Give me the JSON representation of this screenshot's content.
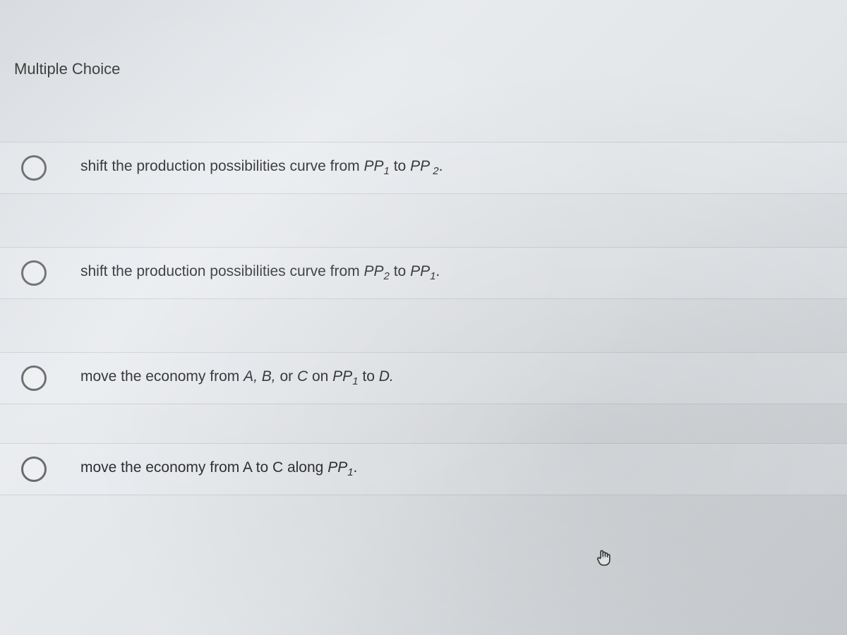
{
  "header": {
    "title": "Multiple Choice"
  },
  "options": [
    {
      "parts": [
        {
          "text": "shift the production possibilities curve from ",
          "italic": false
        },
        {
          "text": "PP",
          "italic": true
        },
        {
          "text": "1",
          "sub": true
        },
        {
          "text": " to ",
          "italic": false
        },
        {
          "text": "PP",
          "italic": true
        },
        {
          "text": " 2",
          "sub": true
        },
        {
          "text": ".",
          "italic": false
        }
      ]
    },
    {
      "parts": [
        {
          "text": "shift the production possibilities curve from ",
          "italic": false
        },
        {
          "text": "PP",
          "italic": true
        },
        {
          "text": "2",
          "sub": true
        },
        {
          "text": " to ",
          "italic": false
        },
        {
          "text": "PP",
          "italic": true
        },
        {
          "text": "1",
          "sub": true
        },
        {
          "text": ".",
          "italic": false
        }
      ]
    },
    {
      "parts": [
        {
          "text": "move the economy from ",
          "italic": false
        },
        {
          "text": "A, B,",
          "italic": true
        },
        {
          "text": " or ",
          "italic": false
        },
        {
          "text": "C",
          "italic": true
        },
        {
          "text": " on ",
          "italic": false
        },
        {
          "text": "PP",
          "italic": true
        },
        {
          "text": "1",
          "sub": true
        },
        {
          "text": " to ",
          "italic": false
        },
        {
          "text": "D.",
          "italic": true
        }
      ]
    },
    {
      "parts": [
        {
          "text": "move the economy from A to C along ",
          "italic": false
        },
        {
          "text": "PP",
          "italic": true
        },
        {
          "text": "1",
          "sub": true
        },
        {
          "text": ".",
          "italic": false
        }
      ]
    }
  ]
}
